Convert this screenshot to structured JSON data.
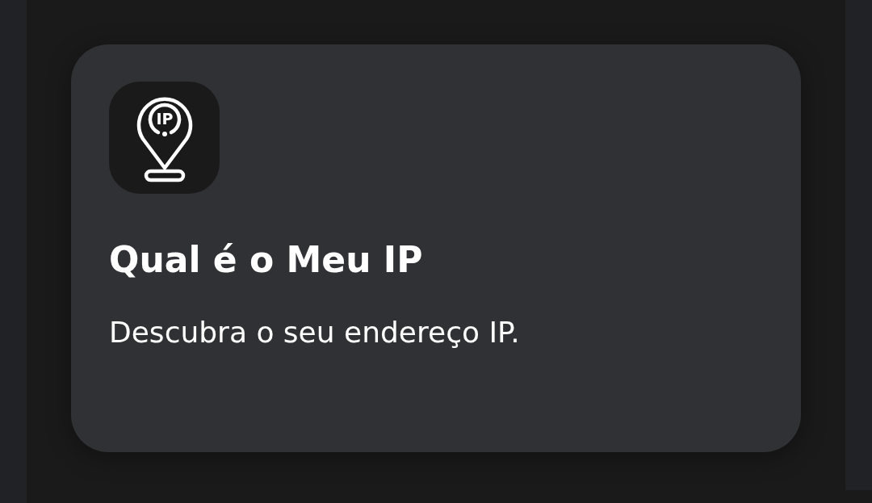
{
  "card": {
    "icon_text": "IP",
    "title": "Qual é o Meu IP",
    "description": "Descubra o seu endereço IP."
  }
}
